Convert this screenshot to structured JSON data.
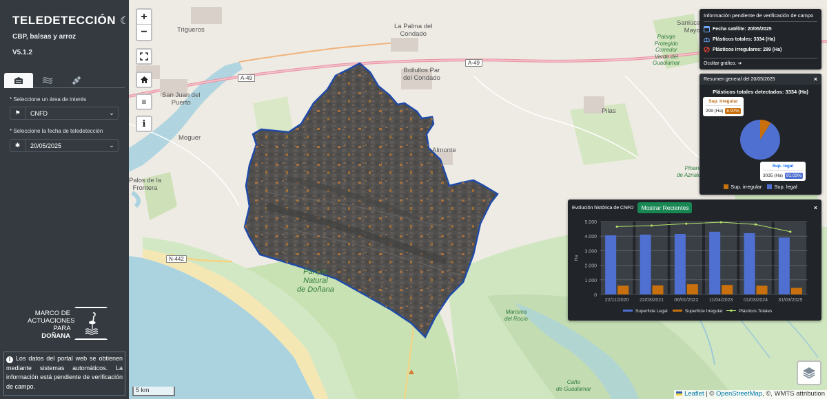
{
  "sidebar": {
    "title": "TELEDETECCIÓN",
    "subtitle": "CBP, balsas y arroz",
    "version": "V5.1.2",
    "tabs": [
      "layers-icon",
      "water-icon",
      "satellite-icon"
    ],
    "area_label": "* Seleccione un área de interés",
    "area_value": "CNFD",
    "date_label": "* Seleccione la fecha de teledetección",
    "date_value": "20/05/2025",
    "logo_line1": "MARCO DE",
    "logo_line2": "ACTUACIONES",
    "logo_line3_prefix": "PARA",
    "logo_line3_bold": "DOÑANA",
    "info_text": "Los datos del portal web se obtienen mediante sistemas automáticos. La información está pendiente de verificación de campo."
  },
  "map": {
    "labels": {
      "trigueros": "Trigueros",
      "la_palma": "La Palma del\nCondado",
      "sanlucar": "Sanlúcar la\nMayor",
      "bollullos": "Bollullos Par\ndel Condado",
      "san_juan": "San Juan del\nPuerto",
      "pilas": "Pilas",
      "moguer": "Moguer",
      "almonte": "Almonte",
      "palos": "Palos de la\nFrontera",
      "parque_natural": "Parque\nNatural\nde Doñana",
      "paisaje": "Paisaje\nProtegido\nCorredor\nVerde del\nGuadiamar",
      "pinares": "Pinares\nde Aznalcázar",
      "marisma": "Marisma\ndel Rocío",
      "cano": "Caño\nde Guadiamar"
    },
    "roads": {
      "a49_west": "A-49",
      "a49_east": "A-49",
      "n442": "N-442"
    },
    "scale": "5 km",
    "attribution_leaflet": "Leaflet",
    "attribution_sep": " | © ",
    "attribution_osm": "OpenStreetMap",
    "attribution_rest": ", ©, WMTS attribution"
  },
  "panel_info": {
    "title": "Información pendiente de verificación de campo",
    "fecha": "Fecha satélite: 20/05/2025",
    "totales": "Plásticos totales: 3334 (Ha)",
    "irregulares": "Plásticos irregulares: 299 (Ha)",
    "ocultar": "Ocultar gráfico."
  },
  "panel_summary": {
    "header": "Resumen general del 20/05/2025",
    "title": "Plásticos totales detectados: 3334 (Ha)",
    "irregular_title": "Sup. irregular",
    "irregular_value": "299 (Ha)",
    "irregular_pct": "8.97%",
    "legal_title": "Sup. legal",
    "legal_value": "3035 (Ha)",
    "legal_pct": "91.03%",
    "legend_irregular": "Sup. irregular",
    "legend_legal": "Sup. legal",
    "colors": {
      "irregular": "#c8700d",
      "legal": "#4f6fd1"
    },
    "pie": {
      "irregular": 299,
      "legal": 3035
    }
  },
  "panel_history": {
    "header": "Evolución histórica de CNFD",
    "button": "Mostrar Recientes"
  },
  "chart_data": {
    "type": "bar",
    "title": "",
    "xlabel": "",
    "ylabel": "Ha",
    "categories": [
      "22/11/2020",
      "22/03/2021",
      "06/01/2022",
      "11/04/2023",
      "01/03/2024",
      "31/03/2025"
    ],
    "ytick_labels": [
      "0",
      "1.000",
      "2.000",
      "3.000",
      "4.000",
      "5.000"
    ],
    "ylim": [
      0,
      5000
    ],
    "series": [
      {
        "name": "Superficie Legal",
        "type": "bar",
        "color": "#4f6fd1",
        "values": [
          4050,
          4100,
          4150,
          4300,
          4200,
          3900
        ]
      },
      {
        "name": "Superficie Irregular",
        "type": "bar",
        "color": "#c8700d",
        "values": [
          600,
          620,
          700,
          650,
          600,
          450
        ]
      },
      {
        "name": "Plásticos Totales",
        "type": "line",
        "color": "#b4e36a",
        "values": [
          4650,
          4720,
          4850,
          4950,
          4800,
          4300
        ]
      }
    ],
    "grid": true,
    "legend": "bottom"
  }
}
